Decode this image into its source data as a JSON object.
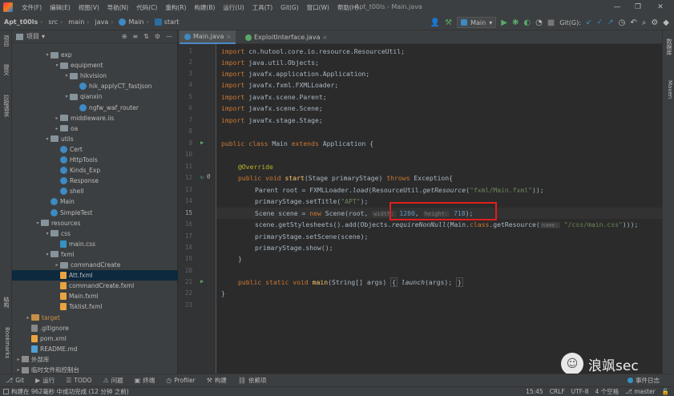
{
  "window": {
    "title": "Apt_t00ls - Main.java",
    "minimize": "—",
    "maximize": "❐",
    "close": "✕"
  },
  "menu": [
    "文件(F)",
    "编辑(E)",
    "视图(V)",
    "导航(N)",
    "代码(C)",
    "重构(R)",
    "构建(B)",
    "运行(U)",
    "工具(T)",
    "Git(G)",
    "窗口(W)",
    "帮助(H)"
  ],
  "breadcrumb": [
    "Apt_t00ls",
    "src",
    "main",
    "java",
    "Main",
    "start"
  ],
  "toolbar": {
    "run_config": "Main",
    "git_label": "Git(G):"
  },
  "left_stripe": {
    "project": "项目",
    "commit": "提交",
    "pull_requests": "拉取请求",
    "structure": "结构",
    "bookmarks": "Bookmarks"
  },
  "right_stripe": {
    "database": "数据库",
    "maven": "Maven"
  },
  "project_panel": {
    "title": "项目",
    "tree": [
      {
        "label": "exp",
        "indent": 3,
        "kind": "folder",
        "arrow": "▾"
      },
      {
        "label": "equipment",
        "indent": 4,
        "kind": "folder",
        "arrow": "▾"
      },
      {
        "label": "hikvision",
        "indent": 5,
        "kind": "folder",
        "arrow": "▾"
      },
      {
        "label": "hik_applyCT_fastjson",
        "indent": 6,
        "kind": "class",
        "arrow": ""
      },
      {
        "label": "qianxin",
        "indent": 5,
        "kind": "folder",
        "arrow": "▾"
      },
      {
        "label": "ngfw_waf_router",
        "indent": 6,
        "kind": "class",
        "arrow": ""
      },
      {
        "label": "middleware.iis",
        "indent": 4,
        "kind": "folder",
        "arrow": "▸"
      },
      {
        "label": "oa",
        "indent": 4,
        "kind": "folder",
        "arrow": "▸"
      },
      {
        "label": "utils",
        "indent": 3,
        "kind": "folder",
        "arrow": "▾"
      },
      {
        "label": "Cert",
        "indent": 4,
        "kind": "class",
        "arrow": ""
      },
      {
        "label": "HttpTools",
        "indent": 4,
        "kind": "class",
        "arrow": ""
      },
      {
        "label": "Kinds_Exp",
        "indent": 4,
        "kind": "class",
        "arrow": ""
      },
      {
        "label": "Response",
        "indent": 4,
        "kind": "class",
        "arrow": ""
      },
      {
        "label": "shell",
        "indent": 4,
        "kind": "class",
        "arrow": ""
      },
      {
        "label": "Main",
        "indent": 3,
        "kind": "class",
        "arrow": ""
      },
      {
        "label": "SimpleTest",
        "indent": 3,
        "kind": "class",
        "arrow": ""
      },
      {
        "label": "resources",
        "indent": 2,
        "kind": "folder",
        "arrow": "▾"
      },
      {
        "label": "css",
        "indent": 3,
        "kind": "folder",
        "arrow": "▾"
      },
      {
        "label": "main.css",
        "indent": 4,
        "kind": "css",
        "arrow": ""
      },
      {
        "label": "fxml",
        "indent": 3,
        "kind": "folder",
        "arrow": "▾"
      },
      {
        "label": "commandCreate",
        "indent": 4,
        "kind": "folder",
        "arrow": "▸"
      },
      {
        "label": "Att.fxml",
        "indent": 4,
        "kind": "xml",
        "arrow": "",
        "selected": true
      },
      {
        "label": "commandCreate.fxml",
        "indent": 4,
        "kind": "xml",
        "arrow": ""
      },
      {
        "label": "Main.fxml",
        "indent": 4,
        "kind": "xml",
        "arrow": ""
      },
      {
        "label": "Tsklist.fxml",
        "indent": 4,
        "kind": "xml",
        "arrow": ""
      },
      {
        "label": "target",
        "indent": 1,
        "kind": "folder-orange",
        "arrow": "▸"
      },
      {
        "label": ".gitignore",
        "indent": 1,
        "kind": "git",
        "arrow": ""
      },
      {
        "label": "pom.xml",
        "indent": 1,
        "kind": "pom",
        "arrow": ""
      },
      {
        "label": "README.md",
        "indent": 1,
        "kind": "md",
        "arrow": ""
      },
      {
        "label": "外部库",
        "indent": 0,
        "kind": "lib",
        "arrow": "▸"
      },
      {
        "label": "临时文件和控制台",
        "indent": 0,
        "kind": "scratch",
        "arrow": "▸"
      }
    ]
  },
  "editor_tabs": [
    {
      "label": "Main.java",
      "active": true,
      "close": "×"
    },
    {
      "label": "ExploitInterface.java",
      "active": false,
      "close": "×"
    }
  ],
  "editor": {
    "current_line": 15,
    "line_numbers": [
      "1",
      "2",
      "3",
      "4",
      "5",
      "6",
      "7",
      "8",
      "9",
      "10",
      "11",
      "12",
      "13",
      "14",
      "15",
      "16",
      "17",
      "18",
      "19",
      "20",
      "21",
      "22",
      "23"
    ],
    "lines": {
      "l1": {
        "kw": "import",
        "rest": " cn.hutool.core.io.resource.ResourceUtil;"
      },
      "l2": {
        "kw": "import",
        "rest": " java.util.Objects;"
      },
      "l3": {
        "kw": "import",
        "rest": " javafx.application.Application;"
      },
      "l4": {
        "kw": "import",
        "rest": " javafx.fxml.FXMLLoader;"
      },
      "l5": {
        "kw": "import",
        "rest": " javafx.scene.Parent;"
      },
      "l6": {
        "kw": "import",
        "rest": " javafx.scene.Scene;"
      },
      "l7": {
        "kw": "import",
        "rest": " javafx.stage.Stage;"
      },
      "l9": {
        "kw1": "public class",
        "name": " Main ",
        "kw2": "extends",
        "rest": " Application {"
      },
      "l11": {
        "ann": "@Override"
      },
      "l12": {
        "kw1": "public void",
        "fn": " start",
        "p1": "(Stage primaryStage) ",
        "kw2": "throws",
        "p2": " Exception{"
      },
      "l13": {
        "p1": "Parent root = FXMLLoader.",
        "it1": "load",
        "p2": "(ResourceUtil.",
        "it2": "getResource",
        "p3": "(",
        "str": "\"fxml/Main.fxml\"",
        "p4": "));"
      },
      "l14": {
        "p1": "primaryStage.setTitle(",
        "str": "\"APT\"",
        "p2": ");"
      },
      "l15": {
        "p1": "Scene scene = ",
        "kw": "new",
        "p2": " Scene(root, ",
        "hint1": "width:",
        "num1": "1280",
        "p3": ", ",
        "hint2": "height:",
        "num2": "718",
        "p4": ");"
      },
      "l16": {
        "p1": "scene.getStylesheets().add(Objects.",
        "it1": "requireNonNull",
        "p2": "(Main.",
        "kw": "class",
        "p3": ".getResource(",
        "hint": "name:",
        "str": "\"/css/main.css\"",
        "p4": ")));"
      },
      "l17": {
        "p1": "primaryStage.setScene(scene);"
      },
      "l18": {
        "p1": "primaryStage.show();"
      },
      "l19": {
        "p1": "}"
      },
      "l21": {
        "kw1": "public static void",
        "fn": " main",
        "p1": "(String[] args) ",
        "b1": "{",
        "it": " launch",
        "p2": "(args); ",
        "b2": "}"
      },
      "l22": {
        "p1": "}"
      }
    }
  },
  "tool_tabs": [
    {
      "icon": "⎇",
      "label": "Git"
    },
    {
      "icon": "▶",
      "label": "运行"
    },
    {
      "icon": "☰",
      "label": "TODO"
    },
    {
      "icon": "⚠",
      "label": "问题"
    },
    {
      "icon": "▣",
      "label": "终端"
    },
    {
      "icon": "◷",
      "label": "Profiler"
    },
    {
      "icon": "⚒",
      "label": "构建"
    },
    {
      "icon": "⛓",
      "label": "依赖项"
    }
  ],
  "event_log": "事件日志",
  "status": {
    "message": "构建在 962毫秒 中成功完成 (12 分钟 之前)",
    "position": "15:45",
    "line_sep": "CRLF",
    "encoding": "UTF-8",
    "indent": "4 个空格",
    "branch": "master"
  },
  "watermark": {
    "text": "浪飒sec",
    "logo": "☺"
  },
  "colors": {
    "highlight_box": "#e01e1e",
    "selection": "#0d293e",
    "keyword": "#cc7832"
  }
}
